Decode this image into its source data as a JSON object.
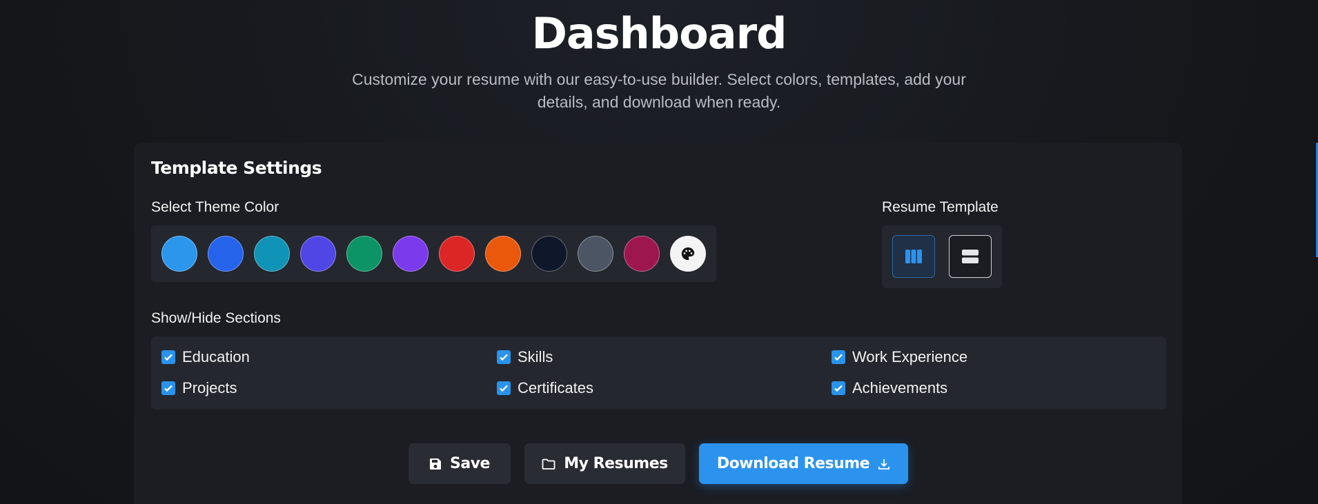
{
  "header": {
    "title": "Dashboard",
    "subtitle": "Customize your resume with our easy-to-use builder. Select colors, templates, add your details, and download when ready."
  },
  "settings": {
    "title": "Template Settings",
    "theme_label": "Select Theme Color",
    "colors": [
      "#2b96ec",
      "#2563eb",
      "#0f93b6",
      "#4f46e5",
      "#0d9466",
      "#7c3aed",
      "#dc2626",
      "#ea580c",
      "#0f172a",
      "#4b5563",
      "#9d174d"
    ],
    "color_picker_icon": "palette-icon",
    "template_label": "Resume Template",
    "templates": [
      {
        "icon": "columns-layout-icon",
        "active": true
      },
      {
        "icon": "rows-layout-icon",
        "active": false
      }
    ],
    "sections_label": "Show/Hide Sections",
    "sections": [
      {
        "label": "Education",
        "checked": true
      },
      {
        "label": "Skills",
        "checked": true
      },
      {
        "label": "Work Experience",
        "checked": true
      },
      {
        "label": "Projects",
        "checked": true
      },
      {
        "label": "Certificates",
        "checked": true
      },
      {
        "label": "Achievements",
        "checked": true
      }
    ]
  },
  "actions": {
    "save_label": "Save",
    "my_resumes_label": "My Resumes",
    "download_label": "Download Resume",
    "accent_color": "#2b93ee"
  }
}
